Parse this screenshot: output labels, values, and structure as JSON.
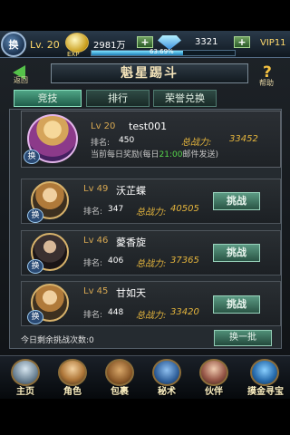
{
  "header": {
    "avatar_label": "换",
    "level": "Lv. 20",
    "exp_tag": "EXP",
    "gold": "2981万",
    "gold_plus": "+",
    "gems": "3321",
    "gems_plus": "+",
    "vip": "VIP11",
    "exp_percent": "63.69%",
    "exp_fraction": 0.6369
  },
  "page": {
    "title": "魁星踢斗",
    "back_label": "返回",
    "help_icon": "?",
    "help_label": "帮助"
  },
  "tabs": [
    {
      "label": "竞技",
      "active": true
    },
    {
      "label": "排行",
      "active": false
    },
    {
      "label": "荣誉兑换",
      "active": false
    }
  ],
  "self": {
    "level": "Lv 20",
    "name": "test001",
    "rank_label": "排名:",
    "rank": "450",
    "power_label": "总战力:",
    "power": "33452",
    "reward_prefix": "当前每日奖励(每日",
    "reward_time": "21:00",
    "reward_suffix": "邮件发送)",
    "badge": "换"
  },
  "opponents": [
    {
      "level": "Lv 49",
      "name": "沃芷蝶",
      "rank_label": "排名:",
      "rank": "347",
      "power_label": "总战力:",
      "power": "40505",
      "badge": "换",
      "button": "挑战"
    },
    {
      "level": "Lv 46",
      "name": "薆香旋",
      "rank_label": "排名:",
      "rank": "406",
      "power_label": "总战力:",
      "power": "37365",
      "badge": "换",
      "button": "挑战"
    },
    {
      "level": "Lv 45",
      "name": "甘如天",
      "rank_label": "排名:",
      "rank": "448",
      "power_label": "总战力:",
      "power": "33420",
      "badge": "换",
      "button": "挑战"
    }
  ],
  "footer": {
    "remaining_label": "今日剩余挑战次数:",
    "remaining_count": "0",
    "swap_button": "换一批"
  },
  "nav": [
    {
      "label": "主页",
      "icon": "home-icon"
    },
    {
      "label": "角色",
      "icon": "character-icon"
    },
    {
      "label": "包裹",
      "icon": "bag-icon"
    },
    {
      "label": "秘术",
      "icon": "spellbook-icon"
    },
    {
      "label": "伙伴",
      "icon": "partner-icon"
    },
    {
      "label": "摸金寻宝",
      "icon": "treasure-icon"
    }
  ],
  "colors": {
    "accent_green": "#56d64b",
    "gold_text": "#e6b63d",
    "active_tab": "#4fa585"
  }
}
